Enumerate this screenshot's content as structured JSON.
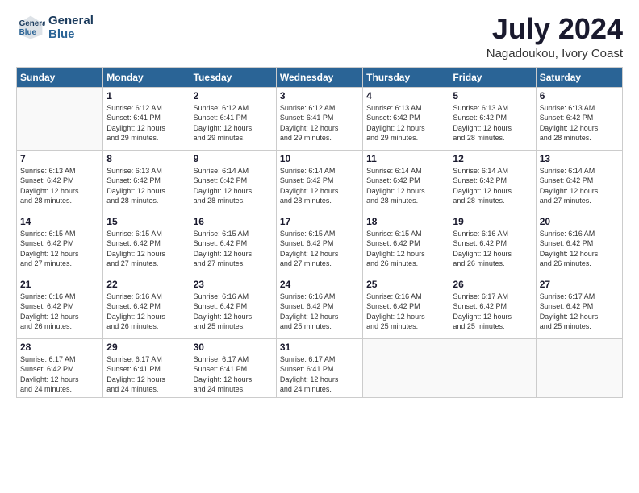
{
  "logo": {
    "line1": "General",
    "line2": "Blue"
  },
  "title": "July 2024",
  "location": "Nagadoukou, Ivory Coast",
  "weekdays": [
    "Sunday",
    "Monday",
    "Tuesday",
    "Wednesday",
    "Thursday",
    "Friday",
    "Saturday"
  ],
  "weeks": [
    [
      {
        "day": "",
        "info": ""
      },
      {
        "day": "1",
        "info": "Sunrise: 6:12 AM\nSunset: 6:41 PM\nDaylight: 12 hours\nand 29 minutes."
      },
      {
        "day": "2",
        "info": "Sunrise: 6:12 AM\nSunset: 6:41 PM\nDaylight: 12 hours\nand 29 minutes."
      },
      {
        "day": "3",
        "info": "Sunrise: 6:12 AM\nSunset: 6:41 PM\nDaylight: 12 hours\nand 29 minutes."
      },
      {
        "day": "4",
        "info": "Sunrise: 6:13 AM\nSunset: 6:42 PM\nDaylight: 12 hours\nand 29 minutes."
      },
      {
        "day": "5",
        "info": "Sunrise: 6:13 AM\nSunset: 6:42 PM\nDaylight: 12 hours\nand 28 minutes."
      },
      {
        "day": "6",
        "info": "Sunrise: 6:13 AM\nSunset: 6:42 PM\nDaylight: 12 hours\nand 28 minutes."
      }
    ],
    [
      {
        "day": "7",
        "info": "Sunrise: 6:13 AM\nSunset: 6:42 PM\nDaylight: 12 hours\nand 28 minutes."
      },
      {
        "day": "8",
        "info": "Sunrise: 6:13 AM\nSunset: 6:42 PM\nDaylight: 12 hours\nand 28 minutes."
      },
      {
        "day": "9",
        "info": "Sunrise: 6:14 AM\nSunset: 6:42 PM\nDaylight: 12 hours\nand 28 minutes."
      },
      {
        "day": "10",
        "info": "Sunrise: 6:14 AM\nSunset: 6:42 PM\nDaylight: 12 hours\nand 28 minutes."
      },
      {
        "day": "11",
        "info": "Sunrise: 6:14 AM\nSunset: 6:42 PM\nDaylight: 12 hours\nand 28 minutes."
      },
      {
        "day": "12",
        "info": "Sunrise: 6:14 AM\nSunset: 6:42 PM\nDaylight: 12 hours\nand 28 minutes."
      },
      {
        "day": "13",
        "info": "Sunrise: 6:14 AM\nSunset: 6:42 PM\nDaylight: 12 hours\nand 27 minutes."
      }
    ],
    [
      {
        "day": "14",
        "info": "Sunrise: 6:15 AM\nSunset: 6:42 PM\nDaylight: 12 hours\nand 27 minutes."
      },
      {
        "day": "15",
        "info": "Sunrise: 6:15 AM\nSunset: 6:42 PM\nDaylight: 12 hours\nand 27 minutes."
      },
      {
        "day": "16",
        "info": "Sunrise: 6:15 AM\nSunset: 6:42 PM\nDaylight: 12 hours\nand 27 minutes."
      },
      {
        "day": "17",
        "info": "Sunrise: 6:15 AM\nSunset: 6:42 PM\nDaylight: 12 hours\nand 27 minutes."
      },
      {
        "day": "18",
        "info": "Sunrise: 6:15 AM\nSunset: 6:42 PM\nDaylight: 12 hours\nand 26 minutes."
      },
      {
        "day": "19",
        "info": "Sunrise: 6:16 AM\nSunset: 6:42 PM\nDaylight: 12 hours\nand 26 minutes."
      },
      {
        "day": "20",
        "info": "Sunrise: 6:16 AM\nSunset: 6:42 PM\nDaylight: 12 hours\nand 26 minutes."
      }
    ],
    [
      {
        "day": "21",
        "info": "Sunrise: 6:16 AM\nSunset: 6:42 PM\nDaylight: 12 hours\nand 26 minutes."
      },
      {
        "day": "22",
        "info": "Sunrise: 6:16 AM\nSunset: 6:42 PM\nDaylight: 12 hours\nand 26 minutes."
      },
      {
        "day": "23",
        "info": "Sunrise: 6:16 AM\nSunset: 6:42 PM\nDaylight: 12 hours\nand 25 minutes."
      },
      {
        "day": "24",
        "info": "Sunrise: 6:16 AM\nSunset: 6:42 PM\nDaylight: 12 hours\nand 25 minutes."
      },
      {
        "day": "25",
        "info": "Sunrise: 6:16 AM\nSunset: 6:42 PM\nDaylight: 12 hours\nand 25 minutes."
      },
      {
        "day": "26",
        "info": "Sunrise: 6:17 AM\nSunset: 6:42 PM\nDaylight: 12 hours\nand 25 minutes."
      },
      {
        "day": "27",
        "info": "Sunrise: 6:17 AM\nSunset: 6:42 PM\nDaylight: 12 hours\nand 25 minutes."
      }
    ],
    [
      {
        "day": "28",
        "info": "Sunrise: 6:17 AM\nSunset: 6:42 PM\nDaylight: 12 hours\nand 24 minutes."
      },
      {
        "day": "29",
        "info": "Sunrise: 6:17 AM\nSunset: 6:41 PM\nDaylight: 12 hours\nand 24 minutes."
      },
      {
        "day": "30",
        "info": "Sunrise: 6:17 AM\nSunset: 6:41 PM\nDaylight: 12 hours\nand 24 minutes."
      },
      {
        "day": "31",
        "info": "Sunrise: 6:17 AM\nSunset: 6:41 PM\nDaylight: 12 hours\nand 24 minutes."
      },
      {
        "day": "",
        "info": ""
      },
      {
        "day": "",
        "info": ""
      },
      {
        "day": "",
        "info": ""
      }
    ]
  ]
}
